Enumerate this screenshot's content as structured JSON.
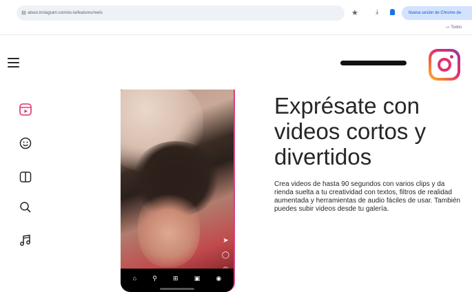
{
  "browser": {
    "url": "about.instagram.com/es-la/features/reels",
    "session_label": "Nueva sesión de Chrome de",
    "sub_link": "Todos"
  },
  "icons": {
    "menu": "hamburger-icon",
    "logo": "instagram-logo",
    "sidebar": [
      "reels-icon",
      "sticker-icon",
      "book-icon",
      "search-icon",
      "music-icon"
    ],
    "phone_nav": [
      "home-icon",
      "search-icon",
      "add-icon",
      "reels-icon",
      "profile-icon"
    ]
  },
  "hero": {
    "headline": "Exprésate con videos cortos y divertidos",
    "body": "Crea videos de hasta 90 segundos con varios clips y da rienda suelta a tu creatividad con textos, filtros de realidad aumentada y herramientas de audio fáciles de usar. También puedes subir videos desde tu galería."
  },
  "colors": {
    "accent": "#e1306c",
    "text": "#262626"
  }
}
